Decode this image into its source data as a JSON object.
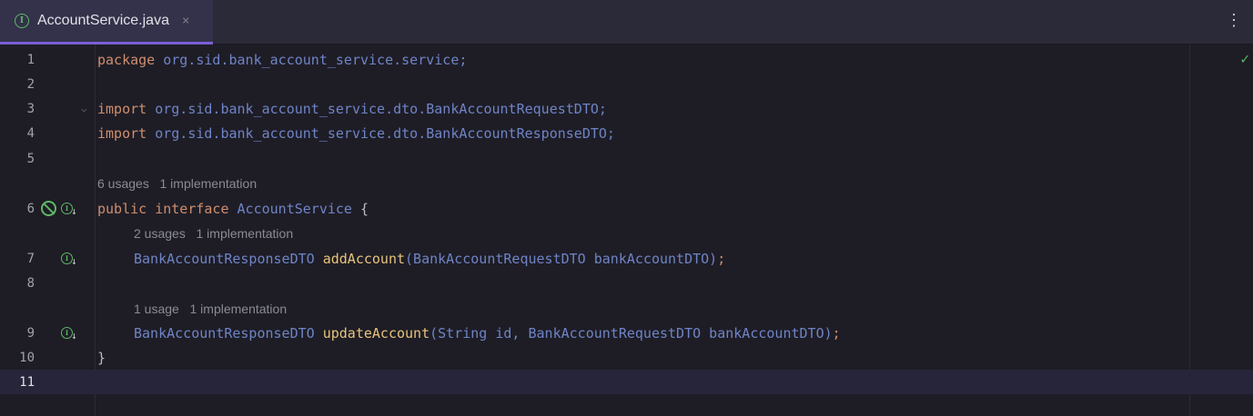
{
  "tab": {
    "title": "AccountService.java",
    "icon": "interface-icon",
    "close": "×",
    "menu": "⋮"
  },
  "status": {
    "icon": "check-icon",
    "glyph": "✓"
  },
  "lines": {
    "l1": {
      "n": "1",
      "kw": "package",
      "rest": " org.sid.bank_account_service.service;"
    },
    "l2": {
      "n": "2"
    },
    "l3": {
      "n": "3",
      "kw": "import",
      "rest": " org.sid.bank_account_service.dto.BankAccountRequestDTO;"
    },
    "l4": {
      "n": "4",
      "kw": "import",
      "rest": " org.sid.bank_account_service.dto.BankAccountResponseDTO;"
    },
    "l5": {
      "n": "5"
    },
    "h6": "6 usages   1 implementation",
    "l6": {
      "n": "6",
      "kw1": "public",
      "kw2": "interface",
      "name": "AccountService",
      "brace": " {"
    },
    "h7": "2 usages   1 implementation",
    "l7": {
      "n": "7",
      "type": "BankAccountResponseDTO",
      "fn": "addAccount",
      "args": "(BankAccountRequestDTO bankAccountDTO)",
      "end": ";"
    },
    "l8": {
      "n": "8"
    },
    "h9": "1 usage   1 implementation",
    "l9": {
      "n": "9",
      "type": "BankAccountResponseDTO",
      "fn": "updateAccount",
      "args": "(String id, BankAccountRequestDTO bankAccountDTO)",
      "end": ";"
    },
    "l10": {
      "n": "10",
      "text": "}"
    },
    "l11": {
      "n": "11"
    }
  }
}
